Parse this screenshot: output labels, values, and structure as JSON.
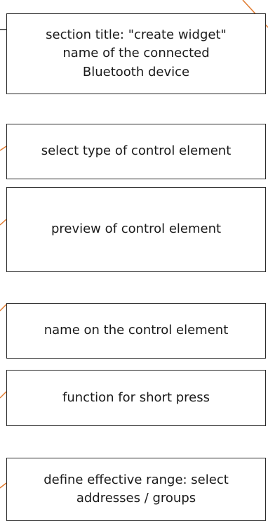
{
  "annotations": [
    {
      "id": "title",
      "lines": [
        "section title: \"create widget\"",
        "name of the connected",
        "Bluetooth device"
      ]
    },
    {
      "id": "type",
      "lines": [
        "select type of control element"
      ]
    },
    {
      "id": "preview",
      "lines": [
        "preview of control element"
      ]
    },
    {
      "id": "name",
      "lines": [
        "name on the control element"
      ]
    },
    {
      "id": "function",
      "lines": [
        "function for short press"
      ]
    },
    {
      "id": "range",
      "lines": [
        "define effective range: select",
        "addresses / groups"
      ]
    }
  ],
  "colors": {
    "box_border": "#2b2b2b",
    "leader_line": "#e07a2e",
    "separator_line": "#2b2b2b"
  }
}
